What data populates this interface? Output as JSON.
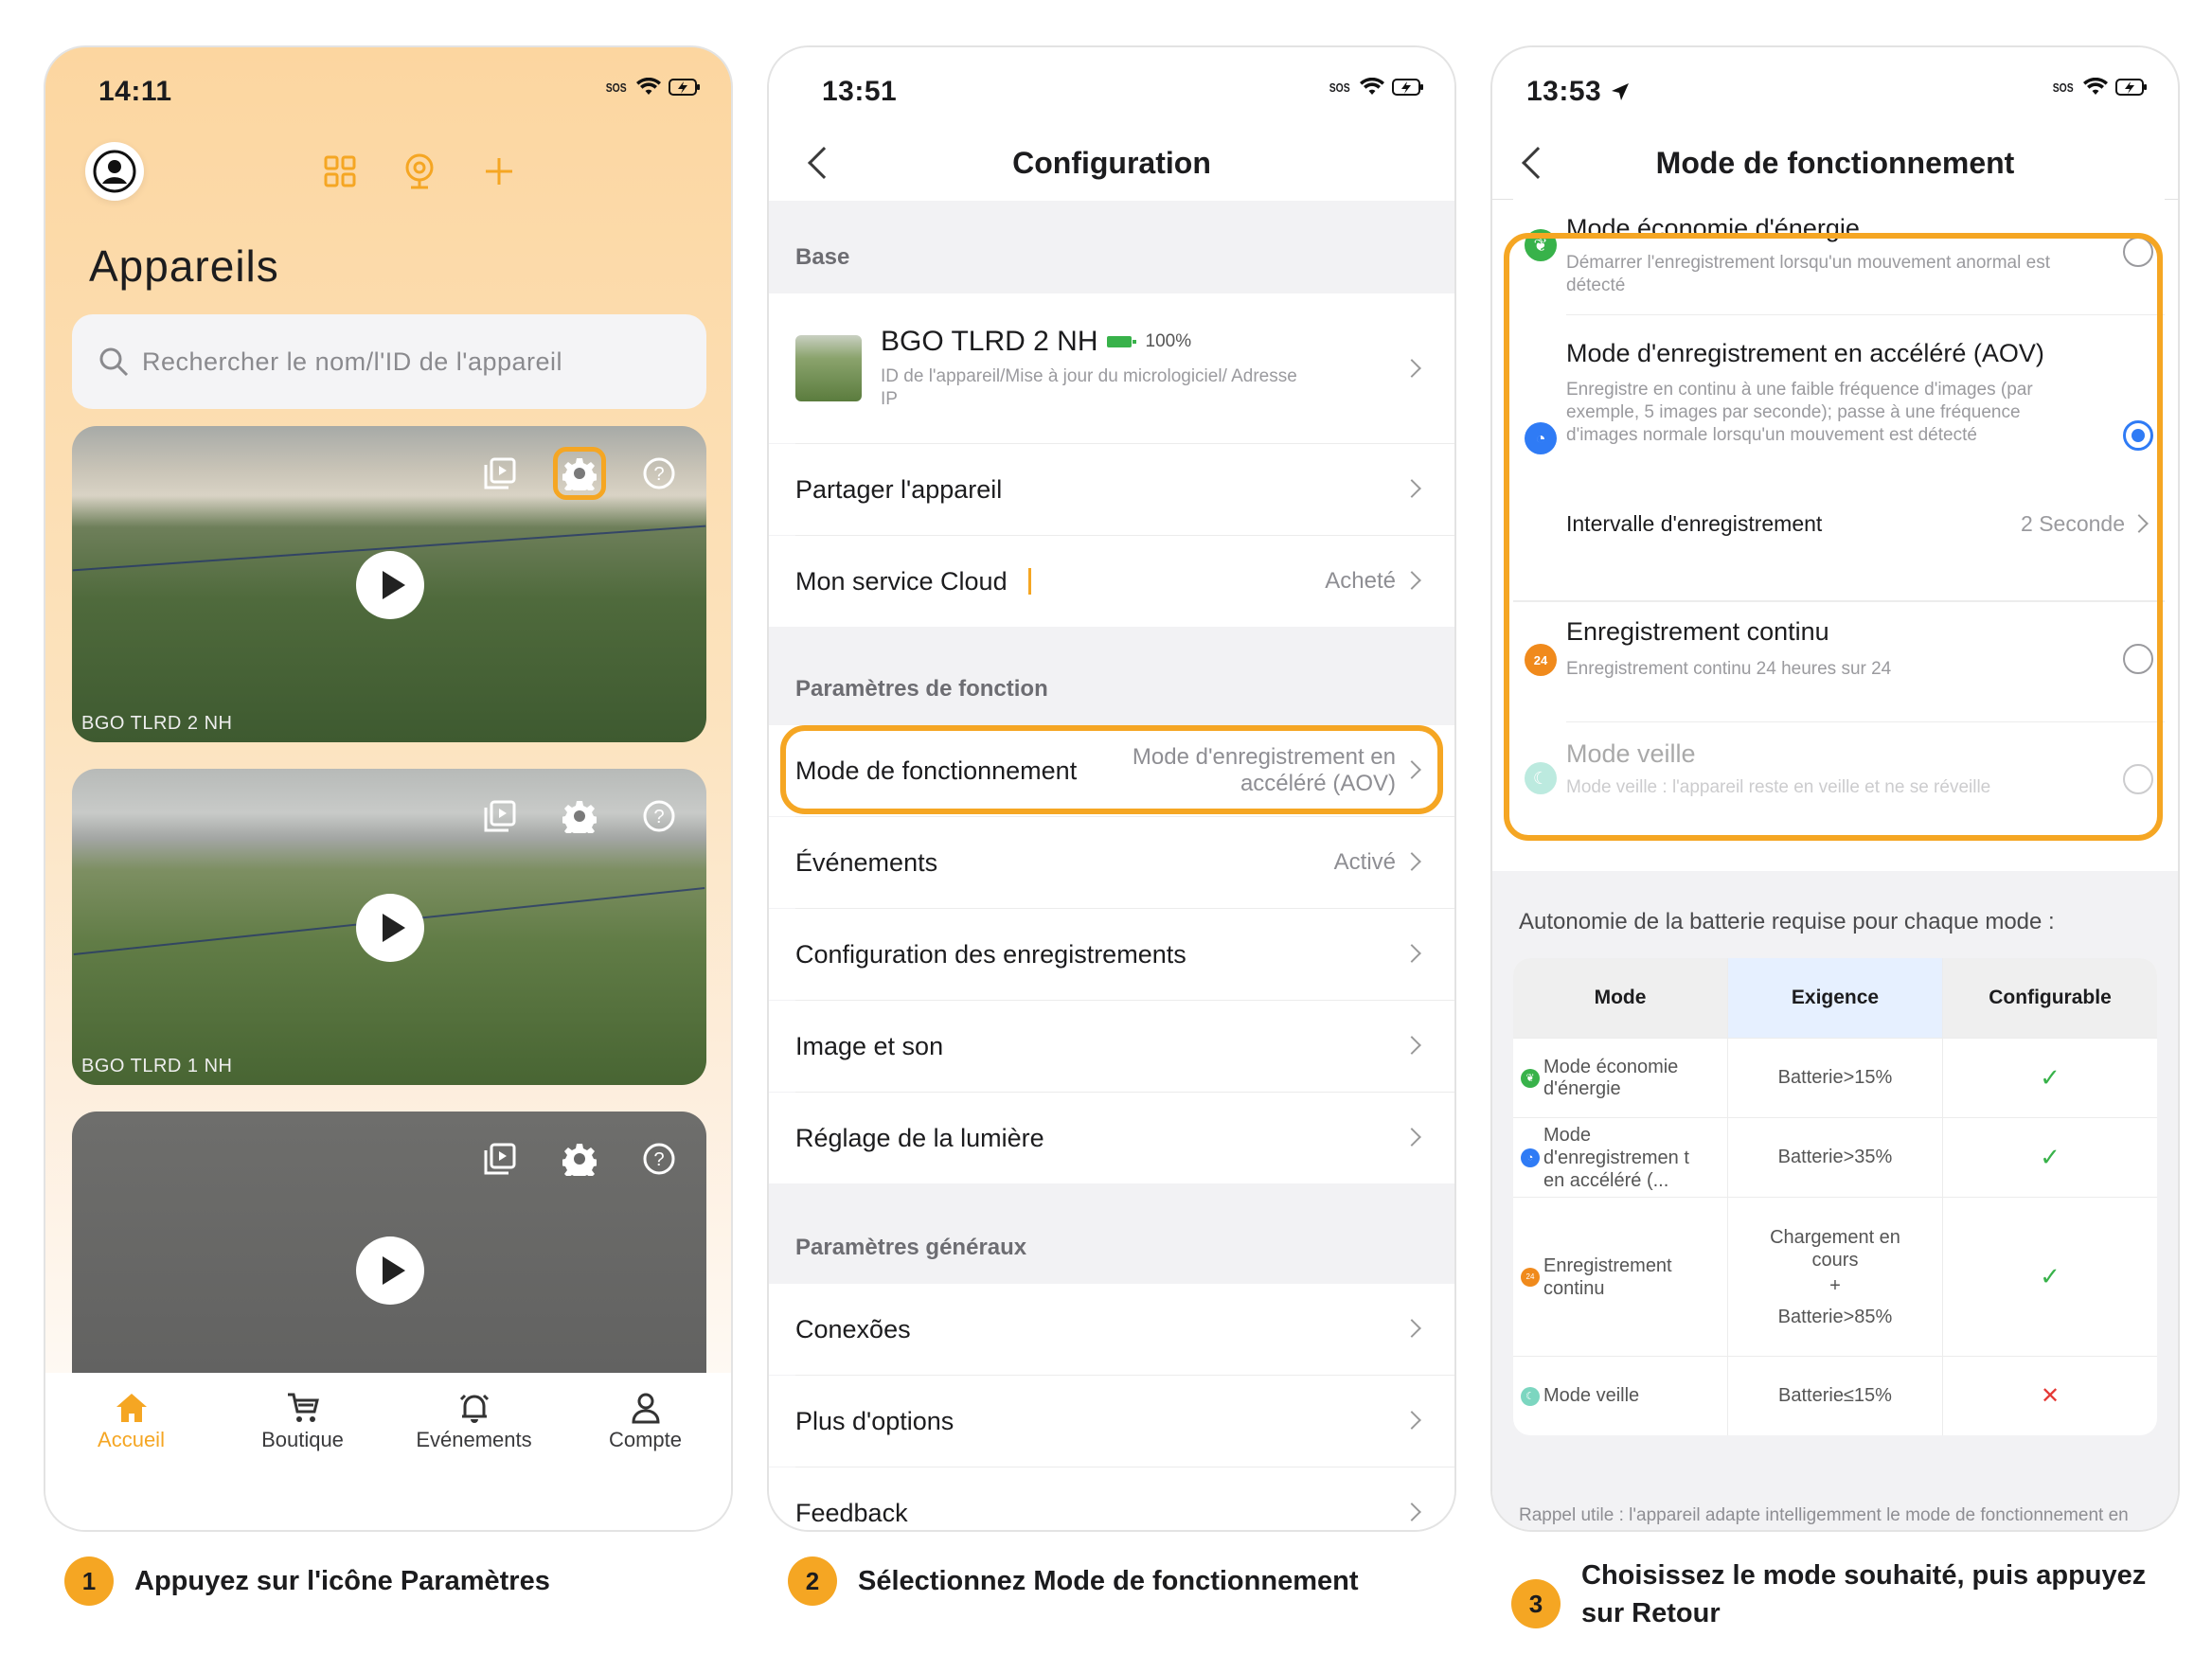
{
  "accent": "#f5a623",
  "screen1": {
    "time": "14:11",
    "sos": "SOS",
    "title": "Appareils",
    "search_placeholder": "Rechercher le nom/l'ID de l'appareil",
    "cameras": [
      {
        "name": "BGO TLRD 2 NH"
      },
      {
        "name": "BGO TLRD 1 NH"
      },
      {
        "name": ""
      }
    ],
    "tabs": [
      {
        "label": "Accueil",
        "icon": "home-icon"
      },
      {
        "label": "Boutique",
        "icon": "cart-icon"
      },
      {
        "label": "Evénements",
        "icon": "bell-icon"
      },
      {
        "label": "Compte",
        "icon": "user-icon"
      }
    ]
  },
  "screen2": {
    "time": "13:51",
    "sos": "SOS",
    "title": "Configuration",
    "section_base": "Base",
    "device_name": "BGO TLRD 2 NH",
    "battery": "100%",
    "device_sub": "ID de l'appareil/Mise à jour du micrologiciel/ Adresse IP",
    "share": "Partager l'appareil",
    "cloud": "Mon service Cloud",
    "cloud_value": "Acheté",
    "section_function": "Paramètres de fonction",
    "mode": "Mode de fonctionnement",
    "mode_value": "Mode d'enregistrement en accéléré (AOV)",
    "events": "Événements",
    "events_value": "Activé",
    "rec_config": "Configuration des enregistrements",
    "image_sound": "Image et son",
    "light": "Réglage de la lumière",
    "section_general": "Paramètres généraux",
    "connections": "Conexões",
    "more": "Plus d'options",
    "feedback": "Feedback"
  },
  "screen3": {
    "time": "13:53",
    "sos": "SOS",
    "title": "Mode de fonctionnement",
    "modes": [
      {
        "title": "Mode économie d'énergie",
        "desc": "Démarrer l'enregistrement lorsqu'un mouvement anormal est détecté",
        "selected": false
      },
      {
        "title": "Mode d'enregistrement en accéléré (AOV)",
        "desc": "Enregistre en continu à une faible fréquence d'images (par exemple, 5 images par seconde); passe à une fréquence d'images normale lorsqu'un mouvement est détecté",
        "selected": true
      },
      {
        "title": "Enregistrement continu",
        "desc": "Enregistrement continu 24 heures sur 24",
        "selected": false
      },
      {
        "title": "Mode veille",
        "desc": "Mode veille : l'appareil reste en veille et ne se réveille",
        "selected": false
      }
    ],
    "interval_label": "Intervalle d'enregistrement",
    "interval_value": "2 Seconde",
    "battery_title": "Autonomie de la batterie requise pour chaque mode :",
    "table_headers": [
      "Mode",
      "Exigence",
      "Configurable"
    ],
    "table_rows": [
      {
        "mode": "Mode économie d'énergie",
        "req": "Batterie>15%",
        "ok": "✓"
      },
      {
        "mode": "Mode d'enregistremen t en accéléré (...",
        "req": "Batterie>35%",
        "ok": "✓"
      },
      {
        "mode": "Enregistrement continu",
        "req_a": "Chargement en cours",
        "plus": "+",
        "req_b": "Batterie>85%",
        "ok": "✓"
      },
      {
        "mode": "Mode veille",
        "req": "Batterie≤15%",
        "ok": "✕"
      }
    ],
    "note": "Rappel utile : l'appareil adapte intelligemment le mode de fonctionnement en fonction du niveau de la batterie afin de maintenir une autonomie optimale"
  },
  "steps": [
    {
      "num": "1",
      "text": "Appuyez sur l'icône Paramètres"
    },
    {
      "num": "2",
      "text": "Sélectionnez Mode de fonctionnement"
    },
    {
      "num": "3",
      "text": "Choisissez le mode souhaité, puis appuyez sur Retour"
    }
  ]
}
